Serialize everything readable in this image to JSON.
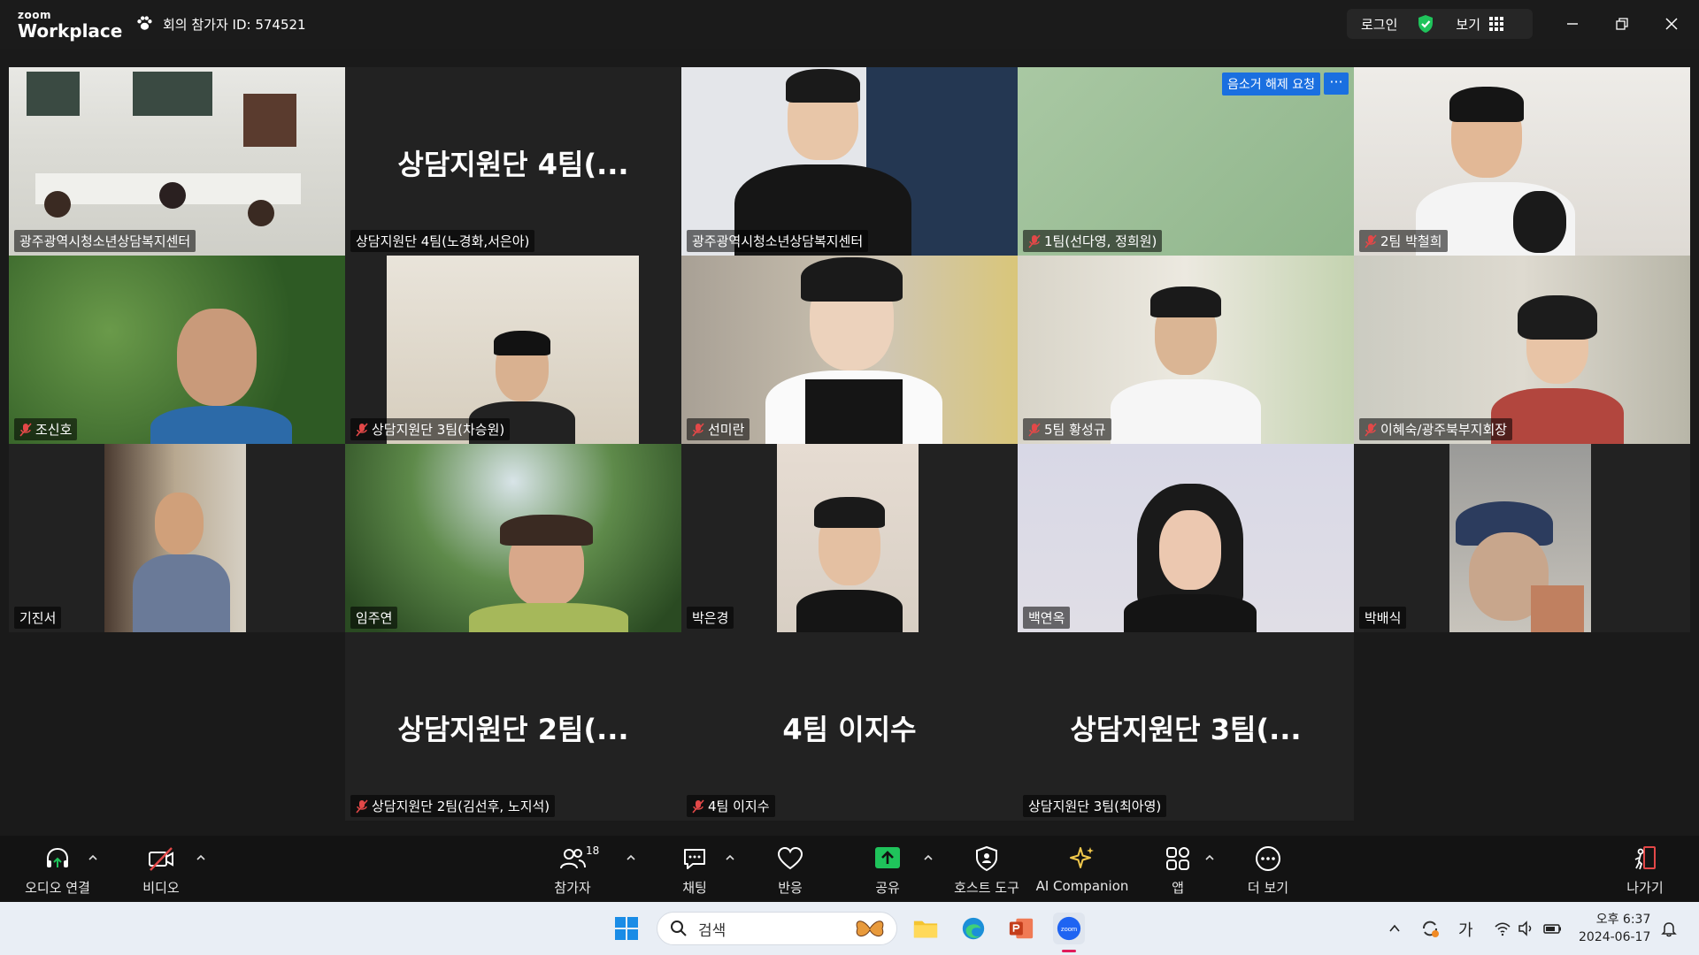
{
  "titlebar": {
    "logo_top": "zoom",
    "logo_bottom": "Workplace",
    "meeting_id": "회의 참가자 ID: 574521",
    "login_label": "로그인",
    "view_label": "보기"
  },
  "tiles": [
    {
      "name": "광주광역시청소년상담복지센터",
      "muted": false,
      "active": true
    },
    {
      "name": "상담지원단 4팀(노경화,서은아)",
      "center_text": "상담지원단 4팀(...",
      "muted": false
    },
    {
      "name": "광주광역시청소년상담복지센터",
      "muted": false
    },
    {
      "name": "1팀(선다영, 정희원)",
      "muted": true,
      "unmute_request": "음소거 해제 요청",
      "more": "···"
    },
    {
      "name": "2팀 박철희",
      "muted": true
    },
    {
      "name": "조신호",
      "muted": true
    },
    {
      "name": "상담지원단 3팀(차승원)",
      "muted": true
    },
    {
      "name": "선미란",
      "muted": true
    },
    {
      "name": "5팀 황성규",
      "muted": true
    },
    {
      "name": "이혜숙/광주북부지회장",
      "muted": true
    },
    {
      "name": "기진서",
      "muted": false
    },
    {
      "name": "임주연",
      "muted": false
    },
    {
      "name": "박은경",
      "muted": false
    },
    {
      "name": "백연옥",
      "muted": false
    },
    {
      "name": "박배식",
      "muted": false
    },
    {
      "name": "상담지원단 2팀(김선후, 노지석)",
      "center_text": "상담지원단 2팀(...",
      "muted": true
    },
    {
      "name": "4팀 이지수",
      "center_text": "4팀 이지수",
      "muted": true
    },
    {
      "name": "상담지원단 3팀(최아영)",
      "center_text": "상담지원단 3팀(...",
      "muted": false
    }
  ],
  "toolbar": {
    "audio": "오디오 연결",
    "video": "비디오",
    "participants": "참가자",
    "participants_count": "18",
    "chat": "채팅",
    "reactions": "반응",
    "share": "공유",
    "host_tools": "호스트 도구",
    "ai_companion": "AI Companion",
    "apps": "앱",
    "more": "더 보기",
    "leave": "나가기"
  },
  "taskbar": {
    "search_placeholder": "검색",
    "ime": "가",
    "time": "오후 6:37",
    "date": "2024-06-17"
  },
  "colors": {
    "active_speaker": "#27d677",
    "unmute_blue": "#1a6fe0",
    "share_green": "#1fc35b",
    "muted_red": "#e34848",
    "ai_gold": "#f2c94c"
  }
}
